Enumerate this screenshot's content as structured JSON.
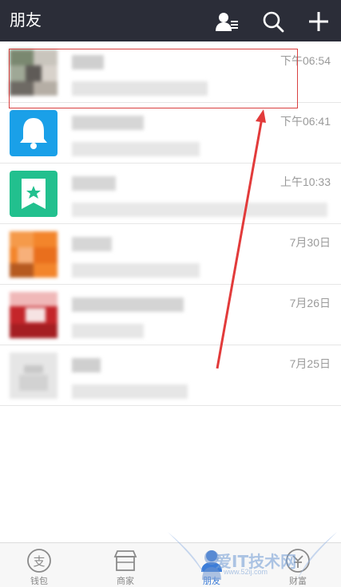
{
  "header": {
    "title": "朋友",
    "icons": [
      "contacts-icon",
      "search-icon",
      "add-icon"
    ]
  },
  "conversations": [
    {
      "time": "下午06:54",
      "avatar_color": "#6f7a64"
    },
    {
      "time": "下午06:41",
      "avatar_color": "#1aa0e8"
    },
    {
      "time": "上午10:33",
      "avatar_color": "#22c08e"
    },
    {
      "time": "7月30日",
      "avatar_color": "#f3852b"
    },
    {
      "time": "7月26日",
      "avatar_color": "#c4252a"
    },
    {
      "time": "7月25日",
      "avatar_color": "#d9d9d9"
    }
  ],
  "tabbar": {
    "tabs": [
      {
        "label": "钱包",
        "icon": "wallet-icon",
        "active": false
      },
      {
        "label": "商家",
        "icon": "store-icon",
        "active": false
      },
      {
        "label": "朋友",
        "icon": "friends-icon",
        "active": true
      },
      {
        "label": "财富",
        "icon": "wealth-icon",
        "active": false
      }
    ]
  },
  "watermark": {
    "text": "爱IT技术网",
    "sub": "www.52ij.com"
  },
  "colors": {
    "header_bg": "#2b2d38",
    "accent": "#3d7dd8",
    "annotation": "#d94040"
  }
}
